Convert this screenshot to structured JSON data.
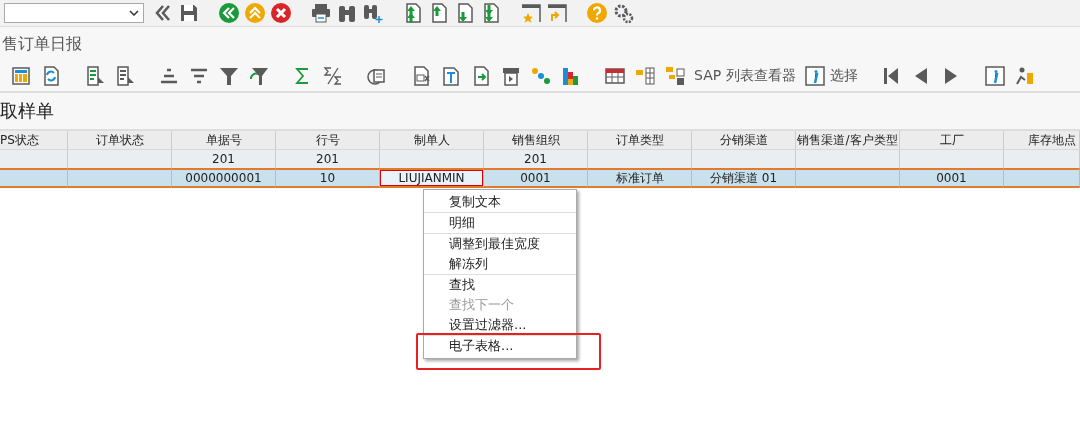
{
  "title": "售订单日报",
  "app_toolbar": {
    "buttons": [
      {
        "label": "SAP 列表查看器",
        "kind": "text"
      },
      {
        "label": "选择",
        "kind": "info"
      }
    ]
  },
  "list_title": "取样单",
  "table": {
    "columns": [
      {
        "label": "PS状态"
      },
      {
        "label": "订单状态"
      },
      {
        "label": "单据号",
        "total": "201"
      },
      {
        "label": "行号",
        "total": "201"
      },
      {
        "label": "制单人"
      },
      {
        "label": "销售组织",
        "total": "201"
      },
      {
        "label": "订单类型"
      },
      {
        "label": "分销渠道"
      },
      {
        "label": "销售渠道/客户类型"
      },
      {
        "label": "工厂"
      },
      {
        "label": "库存地点"
      }
    ],
    "rows": [
      {
        "selected": true,
        "cells": [
          {
            "focused": false
          },
          {
            "focused": false
          },
          {
            "text": "0000000001",
            "focused": false
          },
          {
            "text": "10",
            "focused": false
          },
          {
            "text": "LIUJIANMIN",
            "focused": true
          },
          {
            "text": "0001",
            "focused": false
          },
          {
            "text": "标准订单",
            "focused": false
          },
          {
            "text": "分销渠道 01",
            "focused": false
          },
          {
            "focused": false
          },
          {
            "text": "0001",
            "focused": false
          },
          {
            "focused": false
          }
        ]
      }
    ]
  },
  "context_menu": {
    "groups": [
      [
        {
          "label": "复制文本",
          "disabled": false,
          "highlighted": false
        }
      ],
      [
        {
          "label": "明细",
          "disabled": false,
          "highlighted": false
        }
      ],
      [
        {
          "label": "调整到最佳宽度",
          "disabled": false,
          "highlighted": false
        },
        {
          "label": "解冻列",
          "disabled": false,
          "highlighted": false
        }
      ],
      [
        {
          "label": "查找",
          "disabled": false,
          "highlighted": false
        },
        {
          "label": "查找下一个",
          "disabled": true,
          "highlighted": false
        },
        {
          "label": "设置过滤器...",
          "disabled": false,
          "highlighted": false
        }
      ],
      [
        {
          "label": "电子表格...",
          "disabled": false,
          "highlighted": true
        }
      ]
    ]
  }
}
